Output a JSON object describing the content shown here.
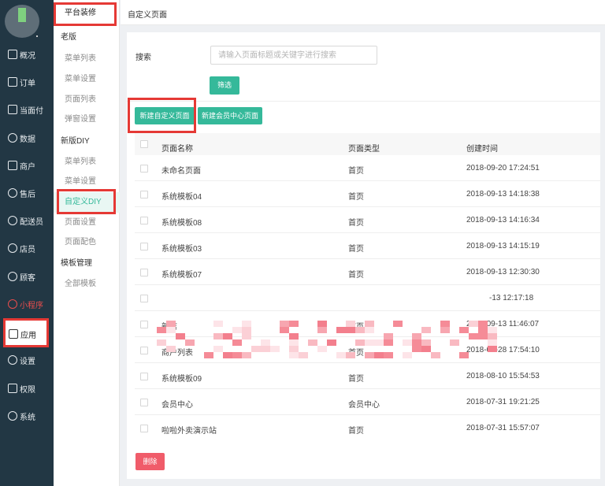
{
  "left_nav": {
    "items": [
      {
        "label": "概况",
        "icon": "overview-icon"
      },
      {
        "label": "订单",
        "icon": "order-icon"
      },
      {
        "label": "当面付",
        "icon": "face-pay-icon"
      },
      {
        "label": "数据",
        "icon": "data-icon"
      },
      {
        "label": "商户",
        "icon": "merchant-icon"
      },
      {
        "label": "售后",
        "icon": "after-sales-icon"
      },
      {
        "label": "配送员",
        "icon": "courier-icon"
      },
      {
        "label": "店员",
        "icon": "clerk-icon"
      },
      {
        "label": "顾客",
        "icon": "customer-icon"
      },
      {
        "label": "小程序",
        "icon": "mini-program-icon"
      },
      {
        "label": "应用",
        "icon": "app-icon"
      },
      {
        "label": "设置",
        "icon": "settings-icon"
      },
      {
        "label": "权限",
        "icon": "lock-icon"
      },
      {
        "label": "系统",
        "icon": "system-icon"
      }
    ],
    "active": "应用",
    "highlight_color": "#e84d4d"
  },
  "sub_nav": {
    "title": "平台装修",
    "group_old": "老版",
    "old_items": [
      "菜单列表",
      "菜单设置",
      "页面列表",
      "弹窗设置"
    ],
    "group_new": "新版DIY",
    "new_items": [
      "菜单列表",
      "菜单设置",
      "自定义DIY",
      "页面设置",
      "页面配色"
    ],
    "group_template": "模板管理",
    "template_items": [
      "全部模板"
    ],
    "active": "自定义DIY"
  },
  "topbar": {
    "title": "自定义页面"
  },
  "search": {
    "label": "搜索",
    "placeholder": "请输入页面标题或关键字进行搜索",
    "filter_button": "筛选"
  },
  "actions": {
    "new_custom_page": "新建自定义页面",
    "new_member_page": "新建会员中心页面",
    "delete": "删除"
  },
  "table": {
    "columns": [
      "页面名称",
      "页面类型",
      "创建时间"
    ],
    "rows": [
      {
        "name": "未命名页面",
        "type": "首页",
        "time": "2018-09-20 17:24:51"
      },
      {
        "name": "系统模板04",
        "type": "首页",
        "time": "2018-09-13 14:18:38"
      },
      {
        "name": "系统模板08",
        "type": "首页",
        "time": "2018-09-13 14:16:34"
      },
      {
        "name": "系统模板03",
        "type": "首页",
        "time": "2018-09-13 14:15:19"
      },
      {
        "name": "系统模板07",
        "type": "首页",
        "time": "2018-09-13 12:30:30"
      },
      {
        "name": "",
        "type": "",
        "time": "-13 12:17:18"
      },
      {
        "name": "新店",
        "type": "首页",
        "time": "2018-09-13 11:46:07"
      },
      {
        "name": "商户列表",
        "type": "首页",
        "time": "2018-08-28 17:54:10"
      },
      {
        "name": "系统模板09",
        "type": "首页",
        "time": "2018-08-10 15:54:53"
      },
      {
        "name": "会员中心",
        "type": "会员中心",
        "time": "2018-07-31 19:21:25"
      },
      {
        "name": "啦啦外卖演示站",
        "type": "首页",
        "time": "2018-07-31 15:57:07"
      }
    ]
  },
  "colors": {
    "sidebar": "#223744",
    "accent": "#35b99a",
    "danger": "#f05c6a",
    "annotation": "#e53935"
  }
}
